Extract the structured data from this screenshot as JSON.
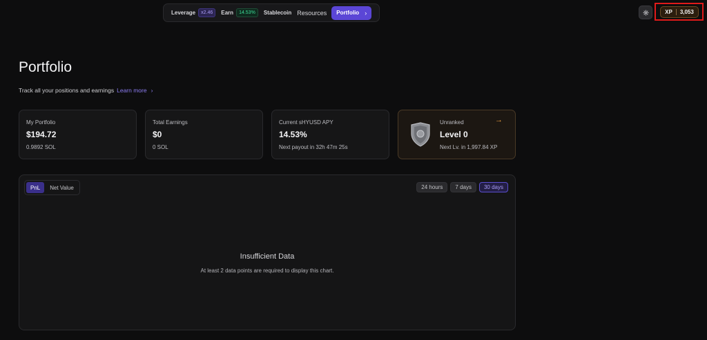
{
  "nav": {
    "leverage_label": "Leverage",
    "leverage_badge": "x2.46",
    "earn_label": "Earn",
    "earn_badge": "14.53%",
    "stablecoin_label": "Stablecoin",
    "resources_label": "Resources",
    "portfolio_label": "Portfolio"
  },
  "topbar": {
    "xp_label": "XP",
    "xp_value": "3,053"
  },
  "page": {
    "title": "Portfolio",
    "subtitle": "Track all your positions and earnings",
    "learn_more": "Learn more"
  },
  "cards": [
    {
      "label": "My Portfolio",
      "value": "$194.72",
      "sub": "0.9892 SOL"
    },
    {
      "label": "Total Earnings",
      "value": "$0",
      "sub": "0 SOL"
    },
    {
      "label": "Current sHYUSD APY",
      "value": "14.53%",
      "sub": "Next payout in 32h 47m 25s"
    },
    {
      "label": "Unranked",
      "value": "Level 0",
      "sub": "Next Lv. in 1,997.84 XP"
    }
  ],
  "chart_panel": {
    "toggles": [
      "PnL",
      "Net Value"
    ],
    "active_toggle": "PnL",
    "ranges": [
      "24 hours",
      "7 days",
      "30 days"
    ],
    "active_range": "30 days",
    "empty_title": "Insufficient Data",
    "empty_message": "At least 2 data points are required to display this chart."
  },
  "colors": {
    "accent": "#5b46d6",
    "background": "#0d0d0e",
    "xp_highlight": "#e11a1a",
    "earn_green": "#3ddc97"
  },
  "icons": {
    "gear": "gear-icon",
    "arrow": "arrow-right-icon",
    "chevron": "chevron-right-icon",
    "rank": "shield-icon"
  }
}
